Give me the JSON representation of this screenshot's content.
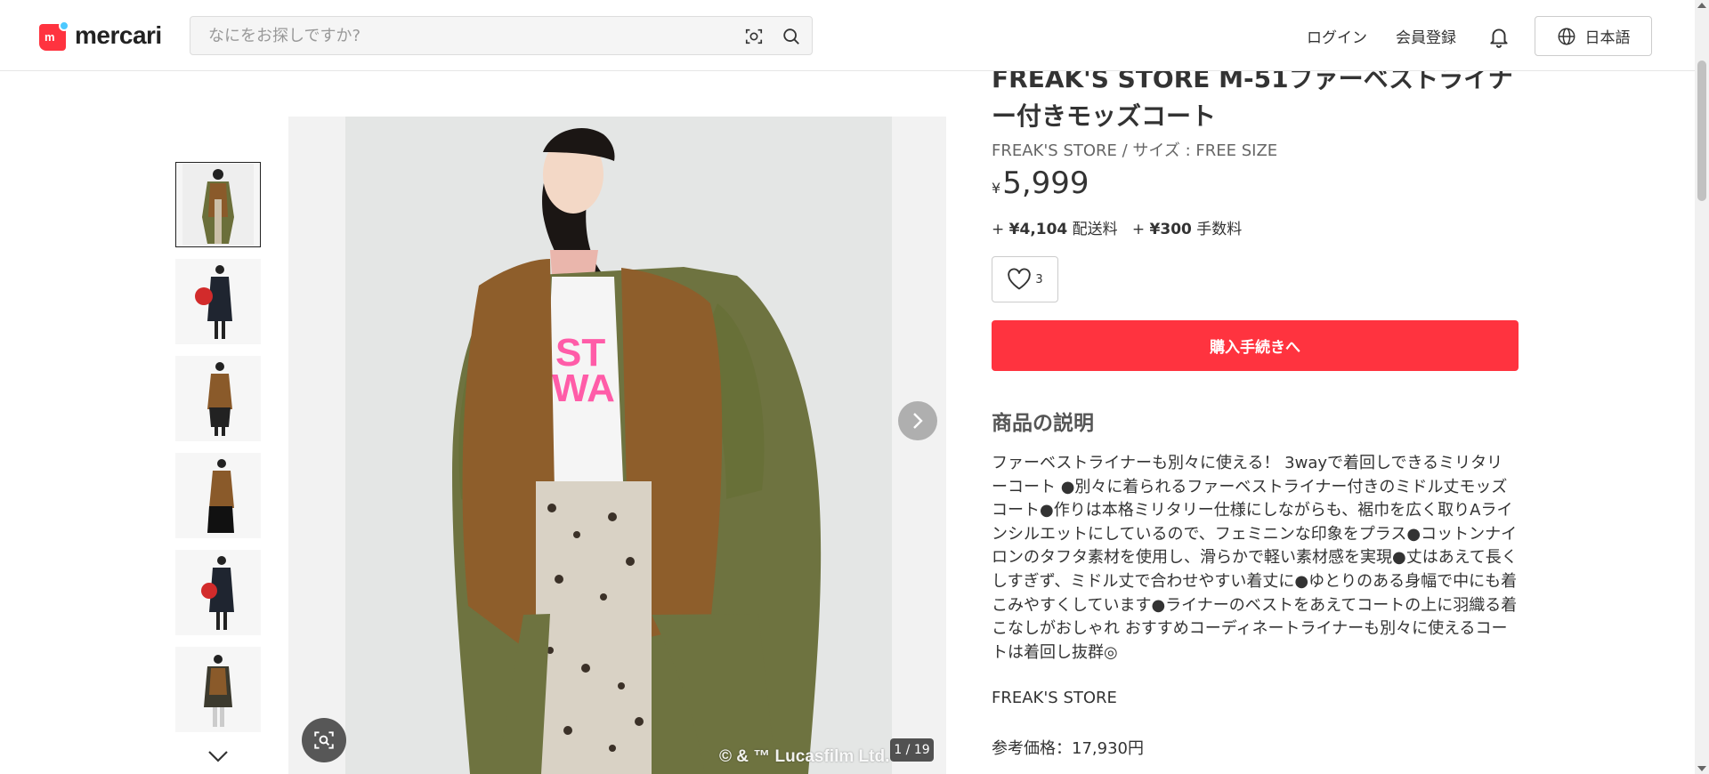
{
  "header": {
    "logo_text": "mercari",
    "search_placeholder": "なにをお探しですか?",
    "login": "ログイン",
    "signup": "会員登録",
    "language": "日本語"
  },
  "gallery": {
    "counter": "1 / 19",
    "copyright": "© & ™ Lucasfilm Ltd.",
    "thumbnail_count": 6
  },
  "product": {
    "title": "FREAK'S STORE M-51ファーベストライナー付きモッズコート",
    "subtitle": "FREAK'S STORE / サイズ : FREE SIZE",
    "currency": "¥",
    "price": "5,999",
    "shipping_prefix": "+ ",
    "shipping_amount": "¥4,104",
    "shipping_label": " 配送料",
    "fee_prefix": "+ ",
    "fee_amount": "¥300",
    "fee_label": " 手数料",
    "likes": "3",
    "buy_button": "購入手続きへ",
    "description_heading": "商品の説明",
    "description": "ファーベストライナーも別々に使える！ 3wayで着回しできるミリタリーコート ●別々に着られるファーベストライナー付きのミドル丈モッズコート●作りは本格ミリタリー仕様にしながらも、裾巾を広く取りAラインシルエットにしているので、フェミニンな印象をプラス●コットンナイロンのタフタ素材を使用し、滑らかで軽い素材感を実現●丈はあえて長くしすぎず、ミドル丈で合わせやすい着丈に●ゆとりのある身幅で中にも着こみやすくしています●ライナーのベストをあえてコートの上に羽織る着こなしがおしゃれ おすすめコーディネートライナーも別々に使えるコートは着回し抜群◎",
    "brand_line": "FREAK'S STORE",
    "reference_price": "参考価格：17,930円"
  },
  "colors": {
    "brand_red": "#ff333f",
    "logo_blue": "#4dc9ff"
  }
}
